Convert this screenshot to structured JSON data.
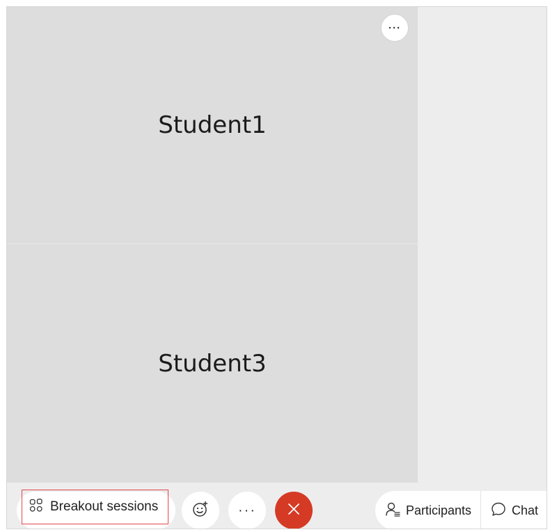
{
  "stage": {
    "tiles": [
      {
        "name": "Student1"
      },
      {
        "name": "Student3"
      }
    ],
    "tile_more_label": "···"
  },
  "toolbar": {
    "breakout_label": "Breakout sessions",
    "more_label": "···",
    "participants_label": "Participants",
    "chat_label": "Chat"
  },
  "icons": {
    "breakout": "grid-icon",
    "react": "emoji-add-icon",
    "end": "close-icon",
    "participants": "person-list-icon",
    "chat": "chat-bubble-icon"
  },
  "colors": {
    "end_call": "#d53a25",
    "highlight_border": "#e3474b",
    "tile_bg": "#dddddd"
  }
}
